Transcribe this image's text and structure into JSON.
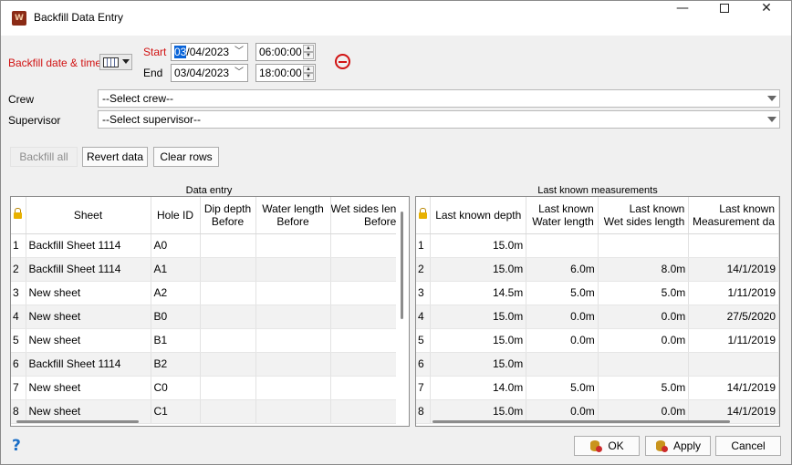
{
  "window": {
    "title": "Backfill Data Entry",
    "app_icon_letter": "W",
    "controls": {
      "minimize": "—",
      "close": "✕"
    }
  },
  "datetime": {
    "label": "Backfill date & time",
    "start_label": "Start",
    "end_label": "End",
    "start_date_selected": "03",
    "start_date_rest": "/04/2023",
    "end_date": "03/04/2023",
    "start_time": "06:00:00",
    "end_time": "18:00:00"
  },
  "crew": {
    "label": "Crew",
    "value": "--Select crew--"
  },
  "supervisor": {
    "label": "Supervisor",
    "value": "--Select supervisor--"
  },
  "actions": {
    "backfill_all": "Backfill all",
    "revert_data": "Revert data",
    "clear_rows": "Clear rows"
  },
  "data_entry": {
    "title": "Data entry",
    "headers": {
      "sheet": "Sheet",
      "hole_id": "Hole ID",
      "dip_depth": [
        "Dip depth",
        "Before"
      ],
      "water_length": [
        "Water length",
        "Before"
      ],
      "wet_sides": [
        "Wet sides len",
        "Before"
      ]
    },
    "rows": [
      {
        "n": "1",
        "sheet": "Backfill Sheet 1114",
        "hole": "A0"
      },
      {
        "n": "2",
        "sheet": "Backfill Sheet 1114",
        "hole": "A1"
      },
      {
        "n": "3",
        "sheet": "New sheet",
        "hole": "A2"
      },
      {
        "n": "4",
        "sheet": "New sheet",
        "hole": "B0"
      },
      {
        "n": "5",
        "sheet": "New sheet",
        "hole": "B1"
      },
      {
        "n": "6",
        "sheet": "Backfill Sheet 1114",
        "hole": "B2"
      },
      {
        "n": "7",
        "sheet": "New sheet",
        "hole": "C0"
      },
      {
        "n": "8",
        "sheet": "New sheet",
        "hole": "C1"
      }
    ]
  },
  "last_known": {
    "title": "Last known measurements",
    "headers": {
      "depth": "Last known depth",
      "water": [
        "Last known",
        "Water length"
      ],
      "wet": [
        "Last known",
        "Wet sides length"
      ],
      "date": [
        "Last known",
        "Measurement da"
      ]
    },
    "rows": [
      {
        "n": "1",
        "depth": "15.0m",
        "water": "",
        "wet": "",
        "date": ""
      },
      {
        "n": "2",
        "depth": "15.0m",
        "water": "6.0m",
        "wet": "8.0m",
        "date": "14/1/2019"
      },
      {
        "n": "3",
        "depth": "14.5m",
        "water": "5.0m",
        "wet": "5.0m",
        "date": "1/11/2019"
      },
      {
        "n": "4",
        "depth": "15.0m",
        "water": "0.0m",
        "wet": "0.0m",
        "date": "27/5/2020"
      },
      {
        "n": "5",
        "depth": "15.0m",
        "water": "0.0m",
        "wet": "0.0m",
        "date": "1/11/2019"
      },
      {
        "n": "6",
        "depth": "15.0m",
        "water": "",
        "wet": "",
        "date": ""
      },
      {
        "n": "7",
        "depth": "14.0m",
        "water": "5.0m",
        "wet": "5.0m",
        "date": "14/1/2019"
      },
      {
        "n": "8",
        "depth": "15.0m",
        "water": "0.0m",
        "wet": "0.0m",
        "date": "14/1/2019"
      }
    ]
  },
  "footer": {
    "help": "?",
    "ok": "OK",
    "apply": "Apply",
    "cancel": "Cancel"
  }
}
